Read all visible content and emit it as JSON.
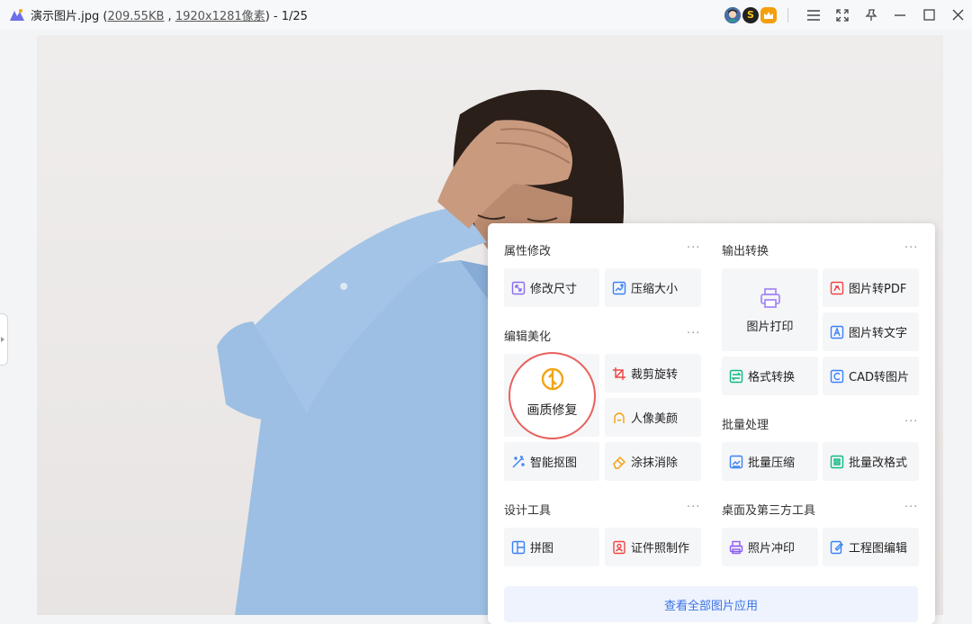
{
  "window": {
    "file_name": "演示图片.jpg",
    "open_paren": " (",
    "file_size": "209.55KB",
    "comma": " , ",
    "dimensions": "1920x1281像素",
    "close_paren": ")",
    "position": " - 1/25"
  },
  "titlebar_icons": [
    "user-avatar-icon",
    "s-badge-icon",
    "crown-vip-icon",
    "menu-icon",
    "fullscreen-icon",
    "pin-icon",
    "minimize-icon",
    "maximize-icon",
    "close-icon"
  ],
  "panel": {
    "sections": {
      "attr": {
        "title": "属性修改",
        "more": "···"
      },
      "output": {
        "title": "输出转换",
        "more": "···"
      },
      "edit": {
        "title": "编辑美化",
        "more": "···"
      },
      "batch": {
        "title": "批量处理",
        "more": "···"
      },
      "design": {
        "title": "设计工具",
        "more": "···"
      },
      "desktop": {
        "title": "桌面及第三方工具",
        "more": "···"
      }
    },
    "tools": {
      "resize": "修改尺寸",
      "compress": "压缩大小",
      "print": "图片打印",
      "to_pdf": "图片转PDF",
      "to_text": "图片转文字",
      "format": "格式转换",
      "cad": "CAD转图片",
      "repair": "画质修复",
      "crop_rotate": "裁剪旋转",
      "beauty": "人像美颜",
      "smart_cutout": "智能抠图",
      "erase": "涂抹消除",
      "batch_compress": "批量压缩",
      "batch_format": "批量改格式",
      "collage": "拼图",
      "id_photo": "证件照制作",
      "photo_print": "照片冲印",
      "drawing_edit": "工程图编辑"
    },
    "see_all": "查看全部图片应用"
  },
  "colors": {
    "accent_blue": "#3b73e6",
    "highlight_ring": "#e8615c",
    "repair_icon": "#f2a516"
  }
}
